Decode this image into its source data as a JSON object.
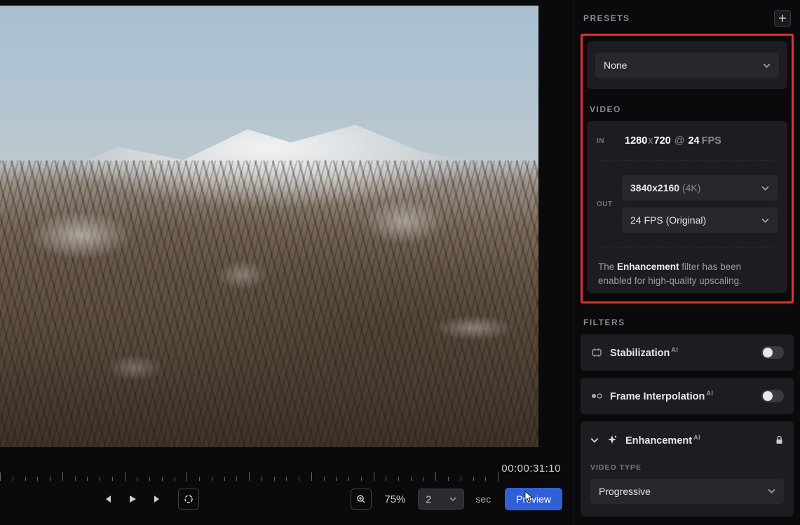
{
  "presets": {
    "section_label": "PRESETS",
    "selected": "None"
  },
  "video": {
    "section_label": "VIDEO",
    "in": {
      "tag": "IN",
      "w": "1280",
      "h": "720",
      "fps": "24",
      "fps_label": "FPS"
    },
    "out": {
      "tag": "OUT",
      "resolution_base": "3840x2160",
      "resolution_suffix": "(4K)",
      "fps_label": "24 FPS (Original)"
    },
    "note_pre": "The ",
    "note_em": "Enhancement",
    "note_post": " filter has been enabled for high-quality upscaling."
  },
  "filters": {
    "section_label": "FILTERS",
    "stabilization": "Stabilization",
    "frame_interp": "Frame Interpolation",
    "enhancement": "Enhancement",
    "ai_badge": "AI",
    "video_type_label": "VIDEO TYPE",
    "video_type_value": "Progressive"
  },
  "timeline": {
    "timecode": "00:00:31:10"
  },
  "controls": {
    "zoom": "75%",
    "seconds": "2",
    "seconds_label": "sec",
    "preview": "Preview"
  }
}
